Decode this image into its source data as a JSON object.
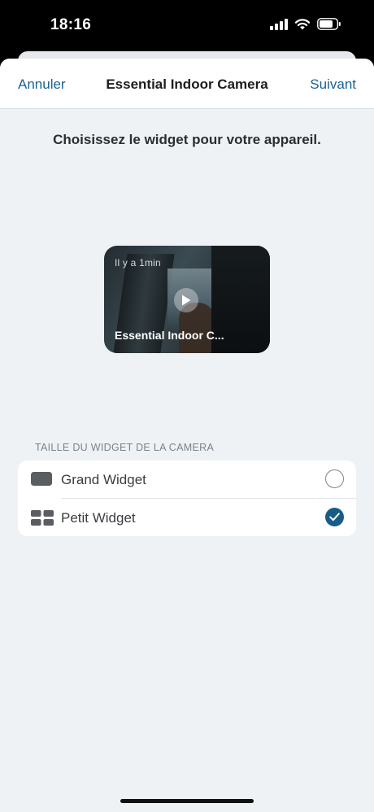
{
  "status_bar": {
    "time": "18:16"
  },
  "nav": {
    "cancel_label": "Annuler",
    "title": "Essential Indoor Camera",
    "next_label": "Suivant"
  },
  "heading": "Choisissez le widget pour votre appareil.",
  "preview": {
    "timestamp": "Il y a 1min",
    "device_name": "Essential Indoor C..."
  },
  "section": {
    "label": "TAILLE DU WIDGET DE LA CAMERA",
    "options": [
      {
        "label": "Grand Widget",
        "icon": "large-widget-icon",
        "selected": false
      },
      {
        "label": "Petit Widget",
        "icon": "small-widget-icon",
        "selected": true
      }
    ]
  },
  "colors": {
    "accent": "#175c86",
    "link": "#1a6291",
    "background": "#eff2f5"
  }
}
